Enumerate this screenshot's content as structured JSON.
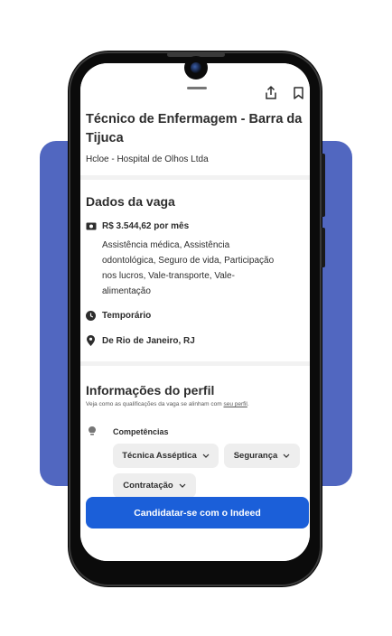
{
  "job": {
    "title_line1": "Técnico de Enfermagem - Barra da",
    "title_line2": "Tijuca",
    "company": "Hcloe - Hospital de Olhos Ltda"
  },
  "details": {
    "heading": "Dados da vaga",
    "salary": "R$ 3.544,62 por mês",
    "benefits_lines": [
      "Assistência médica, Assistência",
      "odontológica, Seguro de vida, Participação",
      "nos lucros, Vale-transporte, Vale-",
      "alimentação"
    ],
    "job_type": "Temporário",
    "location": "De Rio de Janeiro, RJ"
  },
  "profile": {
    "heading": "Informações do perfil",
    "subtitle_prefix": "Veja como as qualificações da vaga se alinham com ",
    "subtitle_link": "seu perfil",
    "subtitle_suffix": ".",
    "competencies_label": "Competências",
    "skills": [
      "Técnica Asséptica",
      "Segurança",
      "Contratação"
    ]
  },
  "apply_button": "Candidatar-se com o Indeed",
  "icons": {
    "share": "share-icon",
    "bookmark": "bookmark-icon",
    "salary": "money-icon",
    "job_type": "clock-icon",
    "location": "location-pin-icon",
    "competencies": "lightbulb-icon",
    "dropdown": "chevron-down-icon"
  },
  "colors": {
    "accent": "#1b5fd9",
    "background_card": "#5167c0"
  }
}
